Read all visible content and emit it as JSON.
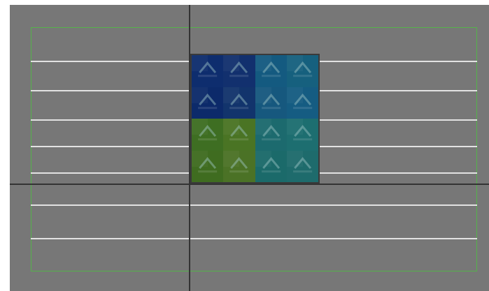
{
  "viewport": {
    "background": "#777777",
    "axis_color": "#333333",
    "safe_frame_color": "#55b24a",
    "guide_color": "#e8e8e8"
  },
  "texture": {
    "rows": 4,
    "cols": 4,
    "icon": "up-arrow-icon",
    "tile_colors": [
      [
        "#0e2d6e",
        "#12306e",
        "#145a80",
        "#16607e"
      ],
      [
        "#0c2a6a",
        "#12346c",
        "#16587e",
        "#155c82"
      ],
      [
        "#3e6e22",
        "#4a7424",
        "#1c6a6e",
        "#1d6e70"
      ],
      [
        "#3f6c20",
        "#4b7226",
        "#1b6a6a",
        "#1e6b6c"
      ]
    ]
  }
}
